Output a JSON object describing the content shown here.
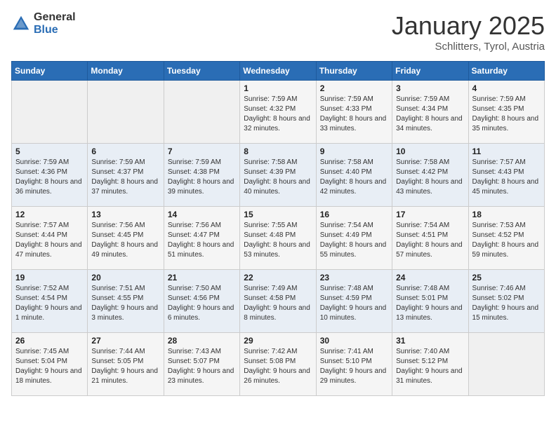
{
  "header": {
    "logo_general": "General",
    "logo_blue": "Blue",
    "title": "January 2025",
    "subtitle": "Schlitters, Tyrol, Austria"
  },
  "weekdays": [
    "Sunday",
    "Monday",
    "Tuesday",
    "Wednesday",
    "Thursday",
    "Friday",
    "Saturday"
  ],
  "weeks": [
    [
      {
        "day": "",
        "sunrise": "",
        "sunset": "",
        "daylight": ""
      },
      {
        "day": "",
        "sunrise": "",
        "sunset": "",
        "daylight": ""
      },
      {
        "day": "",
        "sunrise": "",
        "sunset": "",
        "daylight": ""
      },
      {
        "day": "1",
        "sunrise": "Sunrise: 7:59 AM",
        "sunset": "Sunset: 4:32 PM",
        "daylight": "Daylight: 8 hours and 32 minutes."
      },
      {
        "day": "2",
        "sunrise": "Sunrise: 7:59 AM",
        "sunset": "Sunset: 4:33 PM",
        "daylight": "Daylight: 8 hours and 33 minutes."
      },
      {
        "day": "3",
        "sunrise": "Sunrise: 7:59 AM",
        "sunset": "Sunset: 4:34 PM",
        "daylight": "Daylight: 8 hours and 34 minutes."
      },
      {
        "day": "4",
        "sunrise": "Sunrise: 7:59 AM",
        "sunset": "Sunset: 4:35 PM",
        "daylight": "Daylight: 8 hours and 35 minutes."
      }
    ],
    [
      {
        "day": "5",
        "sunrise": "Sunrise: 7:59 AM",
        "sunset": "Sunset: 4:36 PM",
        "daylight": "Daylight: 8 hours and 36 minutes."
      },
      {
        "day": "6",
        "sunrise": "Sunrise: 7:59 AM",
        "sunset": "Sunset: 4:37 PM",
        "daylight": "Daylight: 8 hours and 37 minutes."
      },
      {
        "day": "7",
        "sunrise": "Sunrise: 7:59 AM",
        "sunset": "Sunset: 4:38 PM",
        "daylight": "Daylight: 8 hours and 39 minutes."
      },
      {
        "day": "8",
        "sunrise": "Sunrise: 7:58 AM",
        "sunset": "Sunset: 4:39 PM",
        "daylight": "Daylight: 8 hours and 40 minutes."
      },
      {
        "day": "9",
        "sunrise": "Sunrise: 7:58 AM",
        "sunset": "Sunset: 4:40 PM",
        "daylight": "Daylight: 8 hours and 42 minutes."
      },
      {
        "day": "10",
        "sunrise": "Sunrise: 7:58 AM",
        "sunset": "Sunset: 4:42 PM",
        "daylight": "Daylight: 8 hours and 43 minutes."
      },
      {
        "day": "11",
        "sunrise": "Sunrise: 7:57 AM",
        "sunset": "Sunset: 4:43 PM",
        "daylight": "Daylight: 8 hours and 45 minutes."
      }
    ],
    [
      {
        "day": "12",
        "sunrise": "Sunrise: 7:57 AM",
        "sunset": "Sunset: 4:44 PM",
        "daylight": "Daylight: 8 hours and 47 minutes."
      },
      {
        "day": "13",
        "sunrise": "Sunrise: 7:56 AM",
        "sunset": "Sunset: 4:45 PM",
        "daylight": "Daylight: 8 hours and 49 minutes."
      },
      {
        "day": "14",
        "sunrise": "Sunrise: 7:56 AM",
        "sunset": "Sunset: 4:47 PM",
        "daylight": "Daylight: 8 hours and 51 minutes."
      },
      {
        "day": "15",
        "sunrise": "Sunrise: 7:55 AM",
        "sunset": "Sunset: 4:48 PM",
        "daylight": "Daylight: 8 hours and 53 minutes."
      },
      {
        "day": "16",
        "sunrise": "Sunrise: 7:54 AM",
        "sunset": "Sunset: 4:49 PM",
        "daylight": "Daylight: 8 hours and 55 minutes."
      },
      {
        "day": "17",
        "sunrise": "Sunrise: 7:54 AM",
        "sunset": "Sunset: 4:51 PM",
        "daylight": "Daylight: 8 hours and 57 minutes."
      },
      {
        "day": "18",
        "sunrise": "Sunrise: 7:53 AM",
        "sunset": "Sunset: 4:52 PM",
        "daylight": "Daylight: 8 hours and 59 minutes."
      }
    ],
    [
      {
        "day": "19",
        "sunrise": "Sunrise: 7:52 AM",
        "sunset": "Sunset: 4:54 PM",
        "daylight": "Daylight: 9 hours and 1 minute."
      },
      {
        "day": "20",
        "sunrise": "Sunrise: 7:51 AM",
        "sunset": "Sunset: 4:55 PM",
        "daylight": "Daylight: 9 hours and 3 minutes."
      },
      {
        "day": "21",
        "sunrise": "Sunrise: 7:50 AM",
        "sunset": "Sunset: 4:56 PM",
        "daylight": "Daylight: 9 hours and 6 minutes."
      },
      {
        "day": "22",
        "sunrise": "Sunrise: 7:49 AM",
        "sunset": "Sunset: 4:58 PM",
        "daylight": "Daylight: 9 hours and 8 minutes."
      },
      {
        "day": "23",
        "sunrise": "Sunrise: 7:48 AM",
        "sunset": "Sunset: 4:59 PM",
        "daylight": "Daylight: 9 hours and 10 minutes."
      },
      {
        "day": "24",
        "sunrise": "Sunrise: 7:48 AM",
        "sunset": "Sunset: 5:01 PM",
        "daylight": "Daylight: 9 hours and 13 minutes."
      },
      {
        "day": "25",
        "sunrise": "Sunrise: 7:46 AM",
        "sunset": "Sunset: 5:02 PM",
        "daylight": "Daylight: 9 hours and 15 minutes."
      }
    ],
    [
      {
        "day": "26",
        "sunrise": "Sunrise: 7:45 AM",
        "sunset": "Sunset: 5:04 PM",
        "daylight": "Daylight: 9 hours and 18 minutes."
      },
      {
        "day": "27",
        "sunrise": "Sunrise: 7:44 AM",
        "sunset": "Sunset: 5:05 PM",
        "daylight": "Daylight: 9 hours and 21 minutes."
      },
      {
        "day": "28",
        "sunrise": "Sunrise: 7:43 AM",
        "sunset": "Sunset: 5:07 PM",
        "daylight": "Daylight: 9 hours and 23 minutes."
      },
      {
        "day": "29",
        "sunrise": "Sunrise: 7:42 AM",
        "sunset": "Sunset: 5:08 PM",
        "daylight": "Daylight: 9 hours and 26 minutes."
      },
      {
        "day": "30",
        "sunrise": "Sunrise: 7:41 AM",
        "sunset": "Sunset: 5:10 PM",
        "daylight": "Daylight: 9 hours and 29 minutes."
      },
      {
        "day": "31",
        "sunrise": "Sunrise: 7:40 AM",
        "sunset": "Sunset: 5:12 PM",
        "daylight": "Daylight: 9 hours and 31 minutes."
      },
      {
        "day": "",
        "sunrise": "",
        "sunset": "",
        "daylight": ""
      }
    ]
  ]
}
